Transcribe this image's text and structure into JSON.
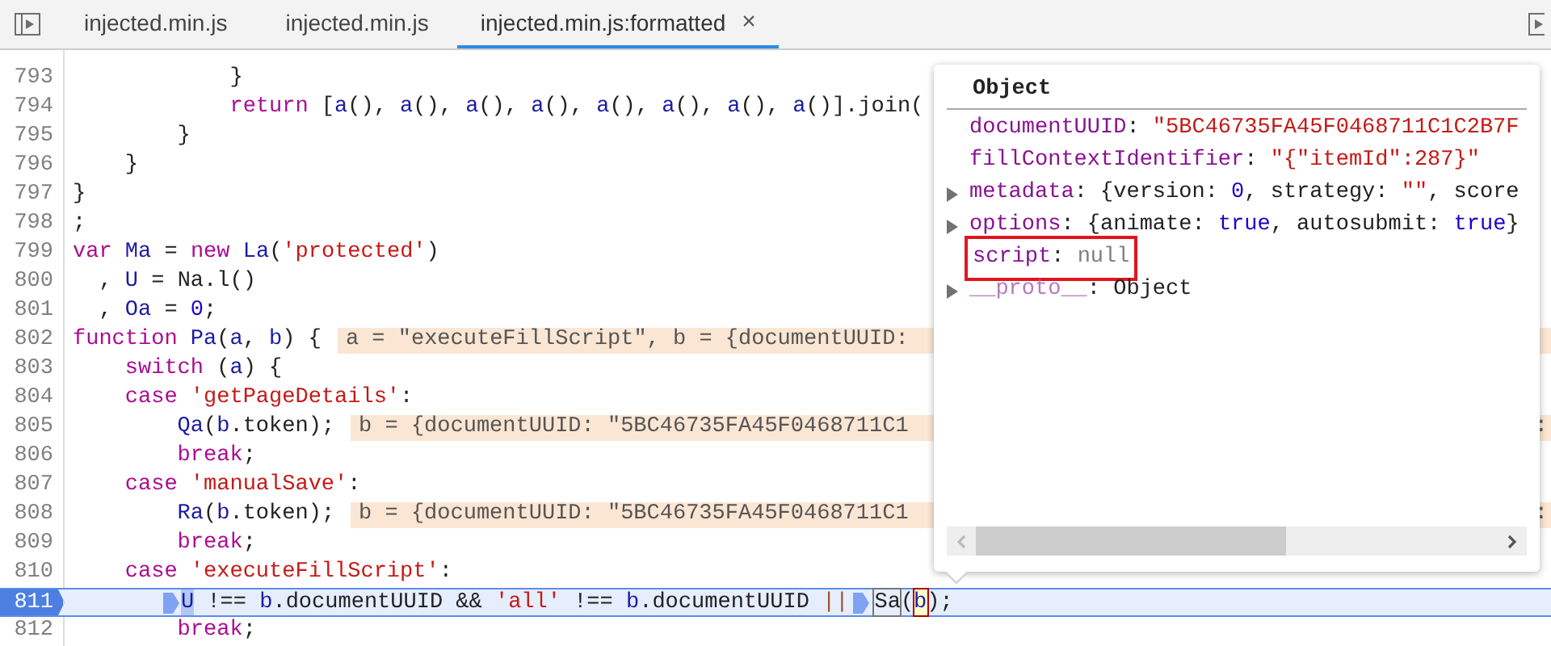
{
  "tabs": [
    {
      "label": "injected.min.js",
      "selected": false
    },
    {
      "label": "injected.min.js",
      "selected": false
    },
    {
      "label": "injected.min.js:formatted",
      "selected": true,
      "close": "×"
    }
  ],
  "code_lines": [
    {
      "number": "793",
      "current": false,
      "tokens": [
        {
          "kind": "plain",
          "text": "            }"
        }
      ]
    },
    {
      "number": "794",
      "current": false,
      "tokens": [
        {
          "kind": "keyword",
          "text": "            return"
        },
        {
          "kind": "plain",
          "text": " ["
        },
        {
          "kind": "variable",
          "text": "a"
        },
        {
          "kind": "plain",
          "text": "(), "
        },
        {
          "kind": "variable",
          "text": "a"
        },
        {
          "kind": "plain",
          "text": "(), "
        },
        {
          "kind": "variable",
          "text": "a"
        },
        {
          "kind": "plain",
          "text": "(), "
        },
        {
          "kind": "variable",
          "text": "a"
        },
        {
          "kind": "plain",
          "text": "(), "
        },
        {
          "kind": "variable",
          "text": "a"
        },
        {
          "kind": "plain",
          "text": "(), "
        },
        {
          "kind": "variable",
          "text": "a"
        },
        {
          "kind": "plain",
          "text": "(), "
        },
        {
          "kind": "variable",
          "text": "a"
        },
        {
          "kind": "plain",
          "text": "(), "
        },
        {
          "kind": "variable",
          "text": "a"
        },
        {
          "kind": "plain",
          "text": "()].join("
        }
      ]
    },
    {
      "number": "795",
      "current": false,
      "tokens": [
        {
          "kind": "plain",
          "text": "        }"
        }
      ]
    },
    {
      "number": "796",
      "current": false,
      "tokens": [
        {
          "kind": "plain",
          "text": "    }"
        }
      ]
    },
    {
      "number": "797",
      "current": false,
      "tokens": [
        {
          "kind": "plain",
          "text": "}"
        }
      ]
    },
    {
      "number": "798",
      "current": false,
      "tokens": [
        {
          "kind": "plain",
          "text": ";"
        }
      ]
    },
    {
      "number": "799",
      "current": false,
      "tokens": [
        {
          "kind": "keyword",
          "text": "var"
        },
        {
          "kind": "variable",
          "text": " Ma"
        },
        {
          "kind": "plain",
          "text": " = "
        },
        {
          "kind": "keyword",
          "text": "new"
        },
        {
          "kind": "variable",
          "text": " La"
        },
        {
          "kind": "plain",
          "text": "("
        },
        {
          "kind": "string",
          "text": "'protected'"
        },
        {
          "kind": "plain",
          "text": ")"
        }
      ]
    },
    {
      "number": "800",
      "current": false,
      "tokens": [
        {
          "kind": "plain",
          "text": "  , "
        },
        {
          "kind": "variable",
          "text": "U"
        },
        {
          "kind": "plain",
          "text": " = Na.l()"
        }
      ]
    },
    {
      "number": "801",
      "current": false,
      "tokens": [
        {
          "kind": "plain",
          "text": "  , "
        },
        {
          "kind": "variable",
          "text": "Oa"
        },
        {
          "kind": "plain",
          "text": " = "
        },
        {
          "kind": "number",
          "text": "0"
        },
        {
          "kind": "plain",
          "text": ";"
        }
      ]
    },
    {
      "number": "802",
      "current": false,
      "tokens": [
        {
          "kind": "keyword",
          "text": "function"
        },
        {
          "kind": "variable",
          "text": " Pa"
        },
        {
          "kind": "plain",
          "text": "("
        },
        {
          "kind": "variable",
          "text": "a"
        },
        {
          "kind": "plain",
          "text": ", "
        },
        {
          "kind": "variable",
          "text": "b"
        },
        {
          "kind": "plain",
          "text": ") {"
        }
      ],
      "inline_value": "a = \"executeFillScript\", b = {documentUUID:"
    },
    {
      "number": "803",
      "current": false,
      "tokens": [
        {
          "kind": "keyword",
          "text": "    switch"
        },
        {
          "kind": "plain",
          "text": " ("
        },
        {
          "kind": "variable",
          "text": "a"
        },
        {
          "kind": "plain",
          "text": ") {"
        }
      ]
    },
    {
      "number": "804",
      "current": false,
      "tokens": [
        {
          "kind": "keyword",
          "text": "    case"
        },
        {
          "kind": "string",
          "text": " 'getPageDetails'"
        },
        {
          "kind": "plain",
          "text": ":"
        }
      ]
    },
    {
      "number": "805",
      "current": false,
      "tokens": [
        {
          "kind": "variable",
          "text": "        Qa"
        },
        {
          "kind": "plain",
          "text": "("
        },
        {
          "kind": "variable",
          "text": "b"
        },
        {
          "kind": "plain",
          "text": ".token);"
        }
      ],
      "inline_value": "b = {documentUUID: \"5BC46735FA45F0468711C1",
      "inline_value_tail": ":"
    },
    {
      "number": "806",
      "current": false,
      "tokens": [
        {
          "kind": "keyword",
          "text": "        break"
        },
        {
          "kind": "plain",
          "text": ";"
        }
      ]
    },
    {
      "number": "807",
      "current": false,
      "tokens": [
        {
          "kind": "keyword",
          "text": "    case"
        },
        {
          "kind": "string",
          "text": " 'manualSave'"
        },
        {
          "kind": "plain",
          "text": ":"
        }
      ]
    },
    {
      "number": "808",
      "current": false,
      "tokens": [
        {
          "kind": "variable",
          "text": "        Ra"
        },
        {
          "kind": "plain",
          "text": "("
        },
        {
          "kind": "variable",
          "text": "b"
        },
        {
          "kind": "plain",
          "text": ".token);"
        }
      ],
      "inline_value": "b = {documentUUID: \"5BC46735FA45F0468711C1",
      "inline_value_tail": ":"
    },
    {
      "number": "809",
      "current": false,
      "tokens": [
        {
          "kind": "keyword",
          "text": "        break"
        },
        {
          "kind": "plain",
          "text": ";"
        }
      ]
    },
    {
      "number": "810",
      "current": false,
      "tokens": [
        {
          "kind": "keyword",
          "text": "    case"
        },
        {
          "kind": "string",
          "text": " 'executeFillScript'"
        },
        {
          "kind": "plain",
          "text": ":"
        }
      ]
    },
    {
      "number": "811",
      "current": true,
      "tokens": [
        {
          "kind": "indented-marker"
        },
        {
          "kind": "current",
          "text": "U"
        },
        {
          "kind": "plain",
          "text": " !== "
        },
        {
          "kind": "variable",
          "text": "b"
        },
        {
          "kind": "plain",
          "text": ".documentUUID && "
        },
        {
          "kind": "string",
          "text": "'all'"
        },
        {
          "kind": "plain",
          "text": " !== "
        },
        {
          "kind": "variable",
          "text": "b"
        },
        {
          "kind": "plain",
          "text": ".documentUUID "
        },
        {
          "kind": "operator",
          "text": "||"
        },
        {
          "kind": "marker"
        },
        {
          "kind": "call",
          "text": "Sa"
        },
        {
          "kind": "plain",
          "text": "("
        },
        {
          "kind": "hovered",
          "text": "b"
        },
        {
          "kind": "plain",
          "text": ");"
        }
      ]
    },
    {
      "number": "812",
      "current": false,
      "tokens": [
        {
          "kind": "keyword",
          "text": "        break"
        },
        {
          "kind": "plain",
          "text": ";"
        }
      ]
    }
  ],
  "popover": {
    "title": "Object",
    "properties": [
      {
        "name": "documentUUID",
        "expandable": false,
        "outlined": false,
        "internal": false,
        "value": [
          {
            "kind": "plain",
            "text": ": "
          },
          {
            "kind": "string",
            "text": "\"5BC46735FA45F0468711C1C2B7F"
          }
        ]
      },
      {
        "name": "fillContextIdentifier",
        "expandable": false,
        "outlined": false,
        "internal": false,
        "value": [
          {
            "kind": "plain",
            "text": ": "
          },
          {
            "kind": "string",
            "text": "\"{\"itemId\":287}\""
          }
        ]
      },
      {
        "name": "metadata",
        "expandable": true,
        "outlined": false,
        "internal": false,
        "value": [
          {
            "kind": "plain",
            "text": ": {version: "
          },
          {
            "kind": "number",
            "text": "0"
          },
          {
            "kind": "plain",
            "text": ", strategy: "
          },
          {
            "kind": "string",
            "text": "\"\""
          },
          {
            "kind": "plain",
            "text": ", score"
          }
        ]
      },
      {
        "name": "options",
        "expandable": true,
        "outlined": false,
        "internal": false,
        "value": [
          {
            "kind": "plain",
            "text": ": {animate: "
          },
          {
            "kind": "number",
            "text": "true"
          },
          {
            "kind": "plain",
            "text": ", autosubmit: "
          },
          {
            "kind": "number",
            "text": "true"
          },
          {
            "kind": "plain",
            "text": "}"
          }
        ]
      },
      {
        "name": "script",
        "expandable": false,
        "outlined": true,
        "internal": false,
        "value": [
          {
            "kind": "plain",
            "text": ": "
          },
          {
            "kind": "null",
            "text": "null"
          }
        ]
      },
      {
        "name": "__proto__",
        "expandable": true,
        "outlined": false,
        "internal": true,
        "value": [
          {
            "kind": "plain",
            "text": ": Object"
          }
        ]
      }
    ]
  }
}
